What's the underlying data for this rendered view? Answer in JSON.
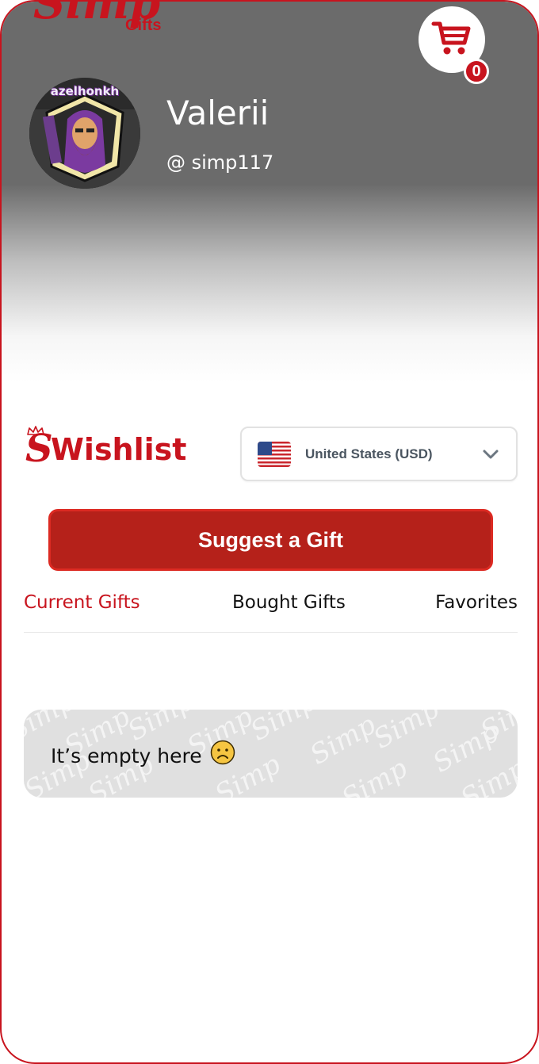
{
  "brand": {
    "name": "Simp",
    "sub": "Gifts"
  },
  "cart": {
    "count": "0"
  },
  "profile": {
    "name": "Valerii",
    "handle": "@ simp117",
    "avatar_text": "azelhonkh"
  },
  "wishlist": {
    "logo_letter": "S",
    "logo_text": "Wishlist",
    "currency": {
      "label": "United States (USD)",
      "flag_icon": "us-flag-icon"
    }
  },
  "actions": {
    "suggest_label": "Suggest a Gift"
  },
  "tabs": [
    {
      "label": "Current Gifts",
      "active": true
    },
    {
      "label": "Bought Gifts",
      "active": false
    },
    {
      "label": "Favorites",
      "active": false
    }
  ],
  "empty_state": {
    "text": "It’s empty here"
  },
  "colors": {
    "brand_red": "#c8141e",
    "button_red": "#b5211a"
  }
}
